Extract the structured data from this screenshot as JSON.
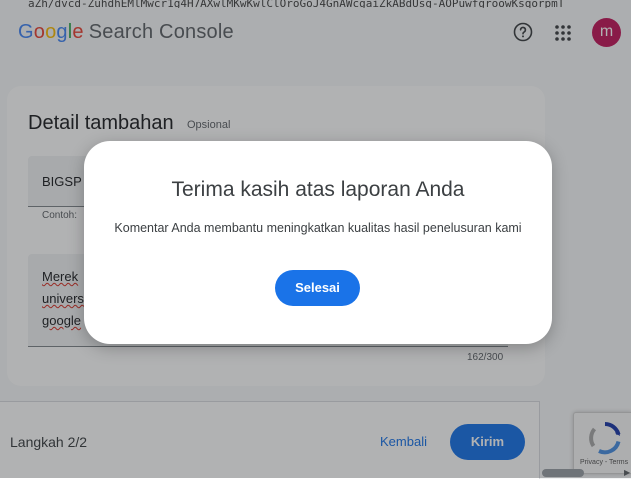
{
  "browser": {
    "url_fragment": "aZh/dvcd-ZuhdhEMlMwcr1g4H7AXwlMKwKwlClOroGoJ4GnAWcgaiZkABdUsg-AOPuwfgroowKsqorpmT"
  },
  "header": {
    "logo_letters": [
      "G",
      "o",
      "o",
      "g",
      "l",
      "e"
    ],
    "product": "Search Console",
    "help_icon": "help-circle-icon",
    "apps_icon": "apps-grid-icon",
    "avatar_letter": "m",
    "avatar_color": "#c2185b"
  },
  "card": {
    "title": "Detail tambahan",
    "optional": "Opsional",
    "field1_value": "BIGSP",
    "field1_helper": "Contoh:",
    "field2_lines": [
      "Merek",
      "univers",
      "google"
    ],
    "counter": "162/300"
  },
  "footer": {
    "step": "Langkah 2/2",
    "back": "Kembali",
    "submit": "Kirim"
  },
  "recaptcha": {
    "text": "Privacy - Terms"
  },
  "dialog": {
    "title": "Terima kasih atas laporan Anda",
    "message": "Komentar Anda membantu meningkatkan kualitas hasil penelusuran kami",
    "done": "Selesai"
  },
  "colors": {
    "accent": "#1a73e8",
    "overlay": "rgba(32,33,36,0.35)"
  }
}
